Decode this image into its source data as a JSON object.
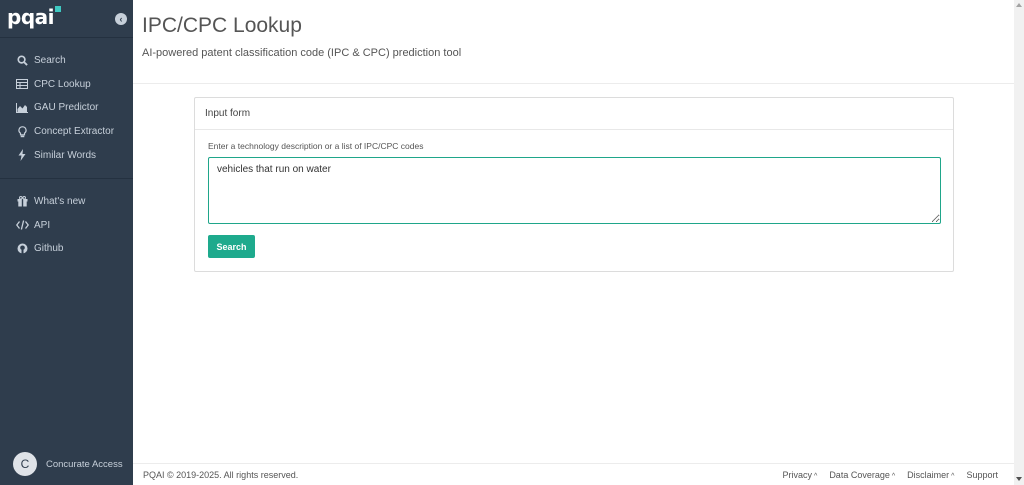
{
  "brand": {
    "logo_text": "pqai"
  },
  "sidebar": {
    "items": [
      {
        "label": "Search",
        "icon": "search-icon"
      },
      {
        "label": "CPC Lookup",
        "icon": "table-icon"
      },
      {
        "label": "GAU Predictor",
        "icon": "area-chart-icon"
      },
      {
        "label": "Concept Extractor",
        "icon": "lightbulb-icon"
      },
      {
        "label": "Similar Words",
        "icon": "bolt-icon"
      }
    ],
    "secondary_items": [
      {
        "label": "What's new",
        "icon": "gift-icon"
      },
      {
        "label": "API",
        "icon": "code-icon"
      },
      {
        "label": "Github",
        "icon": "github-icon"
      }
    ],
    "user": {
      "initial": "C",
      "label": "Concurate Access"
    }
  },
  "header": {
    "title": "IPC/CPC Lookup",
    "subtitle": "AI-powered patent classification code (IPC & CPC) prediction tool"
  },
  "form": {
    "card_title": "Input form",
    "field_label": "Enter a technology description or a list of IPC/CPC codes",
    "textarea_value": "vehicles that run on water",
    "button_label": "Search"
  },
  "footer": {
    "copyright": "PQAI © 2019-2025. All rights reserved.",
    "links": [
      {
        "label": "Privacy",
        "caret": "^"
      },
      {
        "label": "Data Coverage",
        "caret": "^"
      },
      {
        "label": "Disclaimer",
        "caret": "^"
      },
      {
        "label": "Support",
        "caret": ""
      }
    ]
  },
  "colors": {
    "sidebar_bg": "#2f3d4d",
    "accent": "#1eaa8d",
    "logo_square": "#3ec9c2"
  }
}
